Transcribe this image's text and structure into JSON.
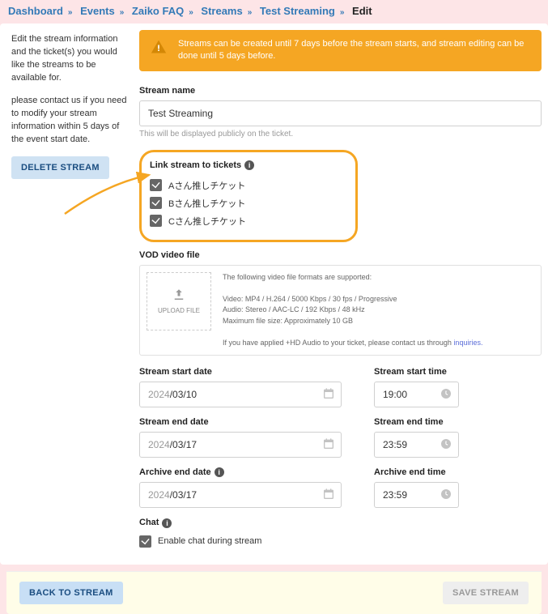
{
  "breadcrumb": [
    "Dashboard",
    "Events",
    "Zaiko FAQ",
    "Streams",
    "Test Streaming",
    "Edit"
  ],
  "sidebar": {
    "p1": "Edit the stream information and the ticket(s) you would like the streams to be available for.",
    "p2": "please contact us if you need to modify your stream information within 5 days of the event start date.",
    "delete_btn": "DELETE STREAM"
  },
  "alert": "Streams can be created until 7 days before the stream starts, and stream editing can be done until 5 days before.",
  "stream_name": {
    "label": "Stream name",
    "value": "Test Streaming",
    "help": "This will be displayed publicly on the ticket."
  },
  "tickets": {
    "label": "Link stream to tickets",
    "items": [
      "Aさん推しチケット",
      "Bさん推しチケット",
      "Cさん推しチケット"
    ]
  },
  "vod": {
    "label": "VOD video file",
    "upload": "UPLOAD FILE",
    "line1": "The following video file formats are supported:",
    "line2": "Video: MP4 / H.264 / 5000 Kbps / 30 fps / Progressive",
    "line3": "Audio: Stereo / AAC-LC / 192 Kbps / 48 kHz",
    "line4": "Maximum file size: Approximately 10 GB",
    "line5a": "If you have applied +HD Audio to your ticket, please contact us through ",
    "line5b": "inquiries."
  },
  "dates": {
    "start_date_label": "Stream start date",
    "start_date_y": "2024",
    "start_date_md": "/03/10",
    "start_time_label": "Stream start time",
    "start_time": "19:00",
    "end_date_label": "Stream end date",
    "end_date_y": "2024",
    "end_date_md": "/03/17",
    "end_time_label": "Stream end time",
    "end_time": "23:59",
    "arch_date_label": "Archive end date",
    "arch_date_y": "2024",
    "arch_date_md": "/03/17",
    "arch_time_label": "Archive end time",
    "arch_time": "23:59"
  },
  "chat": {
    "label": "Chat",
    "option": "Enable chat during stream"
  },
  "footer": {
    "back": "BACK TO STREAM",
    "save": "SAVE STREAM"
  }
}
